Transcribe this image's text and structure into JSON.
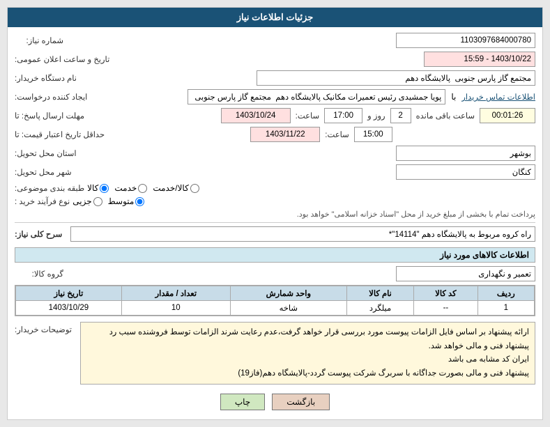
{
  "header": {
    "title": "جزئیات اطلاعات نیاز"
  },
  "fields": {
    "shomara_niyaz_label": "شماره نیاز:",
    "shomara_niyaz_value": "1103097684000780",
    "tarikh_label": "تاریخ و ساعت اعلان عمومی:",
    "tarikh_value": "1403/10/22 - 15:59",
    "nam_dastgah_label": "نام دستگاه خریدار:",
    "nam_dastgah_value": "مجتمع گاز پارس جنوبی  پالایشگاه دهم",
    "ijad_label": "ایجاد کننده درخواست:",
    "ijad_value": "پویا جمشیدی رئیس تعمیرات مکانیک پالایشگاه دهم  مجتمع گاز پارس جنوبی  با",
    "info_link": "اطلاعات تماس خریدار",
    "mohlet_label": "مهلت ارسال پاسخ: تا",
    "date1": "1403/10/24",
    "saaat_label": "ساعت:",
    "saaat_value": "17:00",
    "roz_label": "روز و",
    "roz_value": "2",
    "baqi_label": "ساعت باقی مانده",
    "baqi_value": "00:01:26",
    "hadaghal_label": "حداقل تاریخ اعتبار قیمت: تا",
    "date2": "1403/11/22",
    "saaat2_label": "ساعت:",
    "saaat2_value": "15:00",
    "ostan_label": "استان محل تحویل:",
    "ostan_value": "بوشهر",
    "shahr_label": "شهر محل تحویل:",
    "shahr_value": "کنگان",
    "tabaghe_label": "طبقه بندی موضوعی:",
    "tabaghe_options": [
      "کالا",
      "خدمت",
      "کالا/خدمت"
    ],
    "tabaghe_selected": "کالا",
    "noe_label": "نوع فرآیند خرید :",
    "noe_options": [
      "جزیی",
      "متوسط"
    ],
    "noe_selected": "متوسط",
    "pardakht_text": "پرداخت تمام با بخشی از مبلغ خرید از محل \"اسناد خزانه اسلامی\" خواهد بود.",
    "serh_label": "سرح کلی نیاز:",
    "serh_value": "راه کروه مربوط به پالایشگاه دهم \"14114\"*",
    "info_kaala_header": "اطلاعات کالاهای مورد نیاز",
    "grohe_label": "گروه کالا:",
    "grohe_value": "تعمیر و نگهداری",
    "table": {
      "headers": [
        "ردیف",
        "کد کالا",
        "نام کالا",
        "واحد شمارش",
        "تعداد / مقدار",
        "تاریخ نیاز"
      ],
      "rows": [
        {
          "radif": "1",
          "kod": "--",
          "nam": "میلگرد",
          "vahed": "شاخه",
          "tedad": "10",
          "tarikh": "1403/10/29"
        }
      ]
    },
    "notes_label": "توضیحات خریدار:",
    "notes_lines": [
      "ارائه پیشنهاد بر اساس فایل الزامات پیوست مورد بررسی قرار خواهد گرفت،عدم رعایت شرند الزامات توسط فروشنده سبب رد",
      "پیشنهاد فنی و مالی خواهد شد.",
      "ایران کد مشابه می باشد",
      "پیشنهاد فنی و مالی بصورت جداگانه با سربرگ شرکت پیوست گردد-پالایشگاه دهم(فاز19)"
    ],
    "btn_print": "چاپ",
    "btn_back": "بازگشت"
  }
}
